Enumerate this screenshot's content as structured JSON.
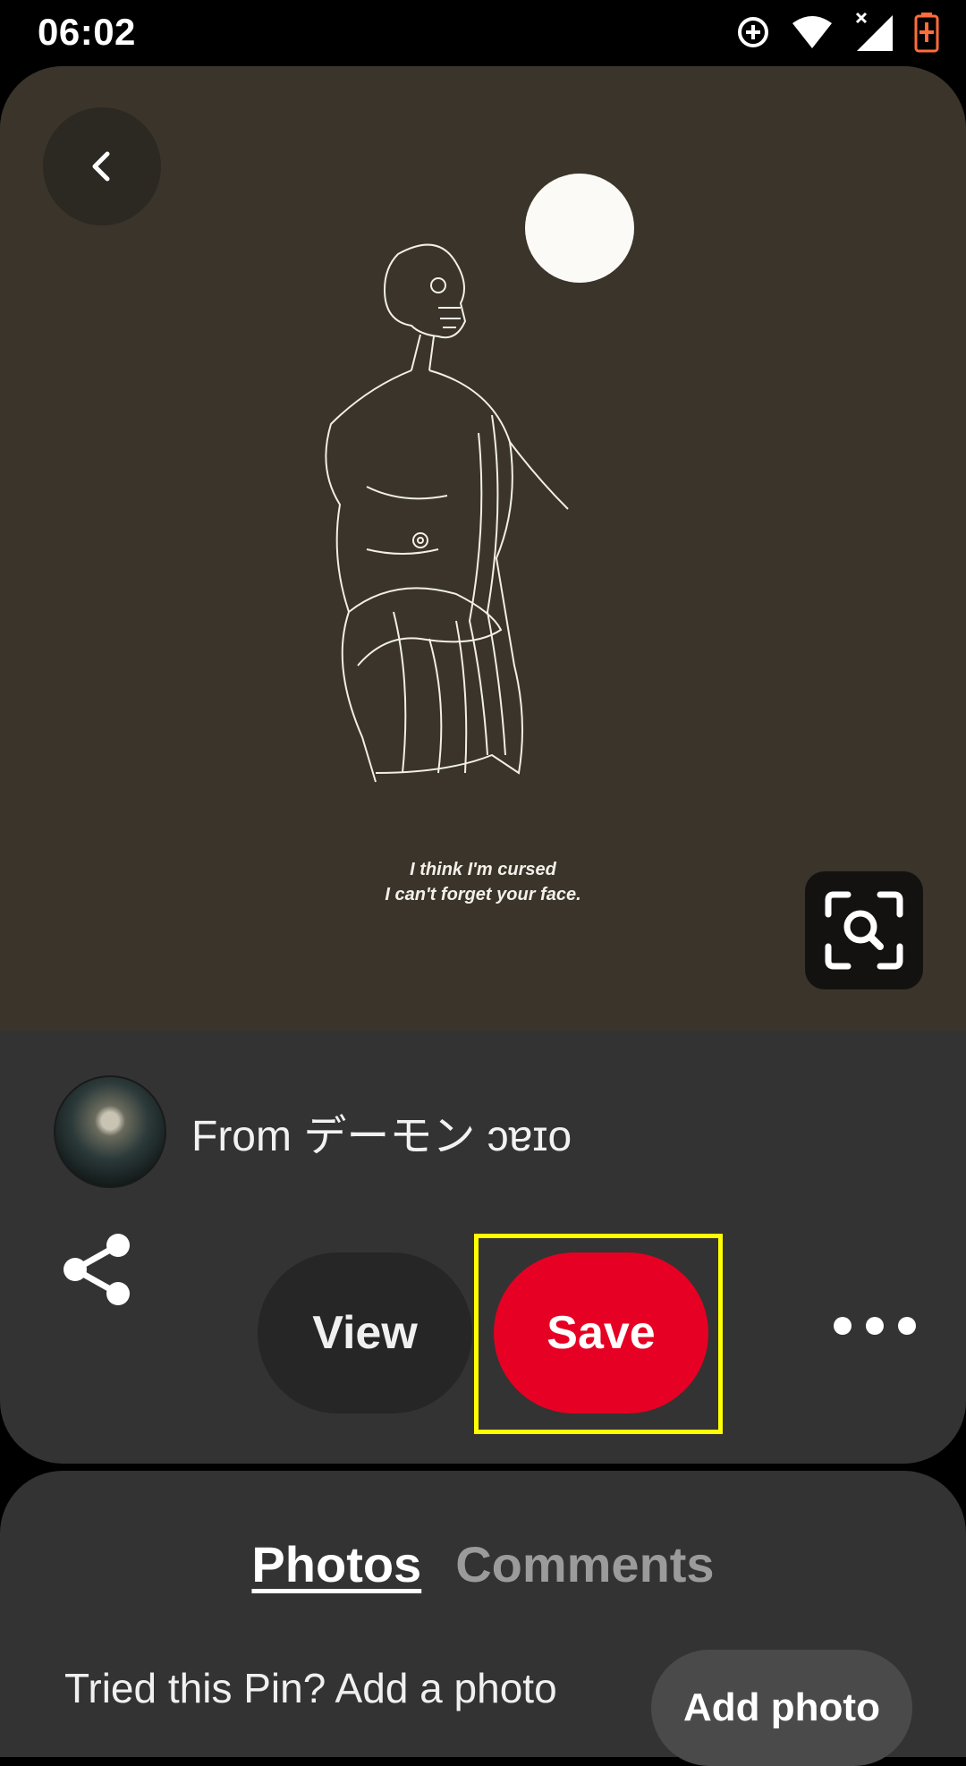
{
  "status_bar": {
    "time": "06:02",
    "icons": [
      "data-saver-icon",
      "wifi-icon",
      "signal-icon",
      "battery-charging-icon"
    ]
  },
  "pin": {
    "image_caption_line1": "I think I'm cursed",
    "image_caption_line2": "I can't forget your face.",
    "creator_prefix": "From",
    "creator_name": "デーモン ᴐɐɪo"
  },
  "actions": {
    "view_label": "View",
    "save_label": "Save"
  },
  "tabs": [
    {
      "label": "Photos",
      "active": true
    },
    {
      "label": "Comments",
      "active": false
    }
  ],
  "photos": {
    "prompt": "Tried this Pin? Add a photo",
    "add_photo_label": "Add photo"
  },
  "colors": {
    "save": "#e60023",
    "highlight": "#ffff00",
    "card": "#333333"
  }
}
